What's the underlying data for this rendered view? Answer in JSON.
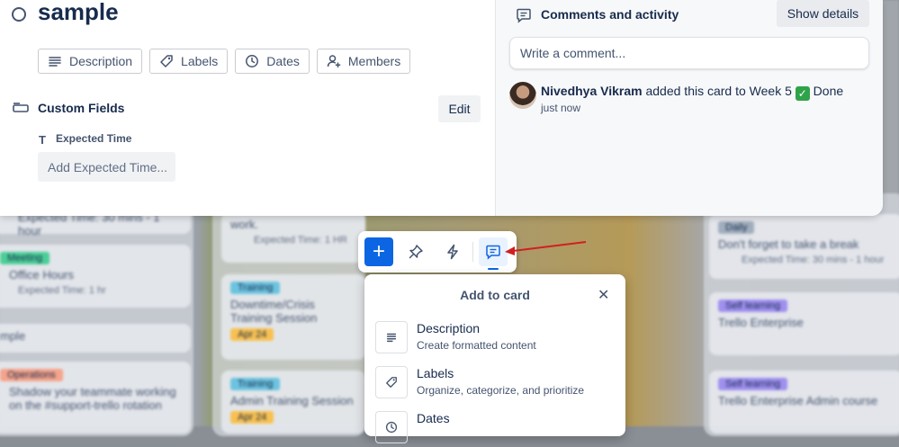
{
  "card": {
    "title": "sample",
    "actions": [
      {
        "label": "Description",
        "icon": "description-icon"
      },
      {
        "label": "Labels",
        "icon": "label-icon"
      },
      {
        "label": "Dates",
        "icon": "clock-icon"
      },
      {
        "label": "Members",
        "icon": "add-member-icon"
      }
    ],
    "custom_fields": {
      "title": "Custom Fields",
      "edit_label": "Edit",
      "field_name": "Expected Time",
      "field_placeholder": "Add Expected Time..."
    }
  },
  "activity": {
    "title": "Comments and activity",
    "show_details_label": "Show details",
    "comment_placeholder": "Write a comment...",
    "entry": {
      "user": "Nivedhya Vikram",
      "action": "added this card to Week 5",
      "list_name": "Done",
      "time": "just now"
    }
  },
  "toolbar": {
    "items": [
      "add-icon",
      "pin-icon",
      "lightning-icon",
      "comment-icon"
    ],
    "active": "comment-icon"
  },
  "add_to_card": {
    "title": "Add to card",
    "items": [
      {
        "name": "Description",
        "desc": "Create formatted content"
      },
      {
        "name": "Labels",
        "desc": "Organize, categorize, and prioritize"
      },
      {
        "name": "Dates",
        "desc": ""
      }
    ]
  },
  "background_board": {
    "col1": [
      {
        "text": "Expected Time: 30 mins - 1 hour"
      },
      {
        "tag": "Meeting",
        "text": "Office Hours",
        "meta": "Expected Time: 1 hr"
      },
      {
        "text": "mple"
      },
      {
        "tag": "Operations",
        "text": "Shadow your teammate working on the #support-trello rotation"
      }
    ],
    "col2": [
      {
        "text": "work.",
        "meta": "Expected Time: 1 HR"
      },
      {
        "tag": "Training",
        "text": "Downtime/Crisis Training Session",
        "badge": "Apr 24"
      },
      {
        "tag": "Training",
        "text": "Admin Training Session",
        "badge": "Apr 24"
      }
    ],
    "col3": [
      {
        "tag": "Daily",
        "text": "Don't forget to take a break",
        "meta": "Expected Time: 30 mins - 1 hour"
      },
      {
        "tag": "Self learning",
        "text": "Trello Enterprise"
      },
      {
        "tag": "Self learning",
        "text": "Trello Enterprise Admin course"
      }
    ]
  },
  "colors": {
    "accent": "#0c66e4",
    "annotation_arrow": "#d11f1f"
  }
}
